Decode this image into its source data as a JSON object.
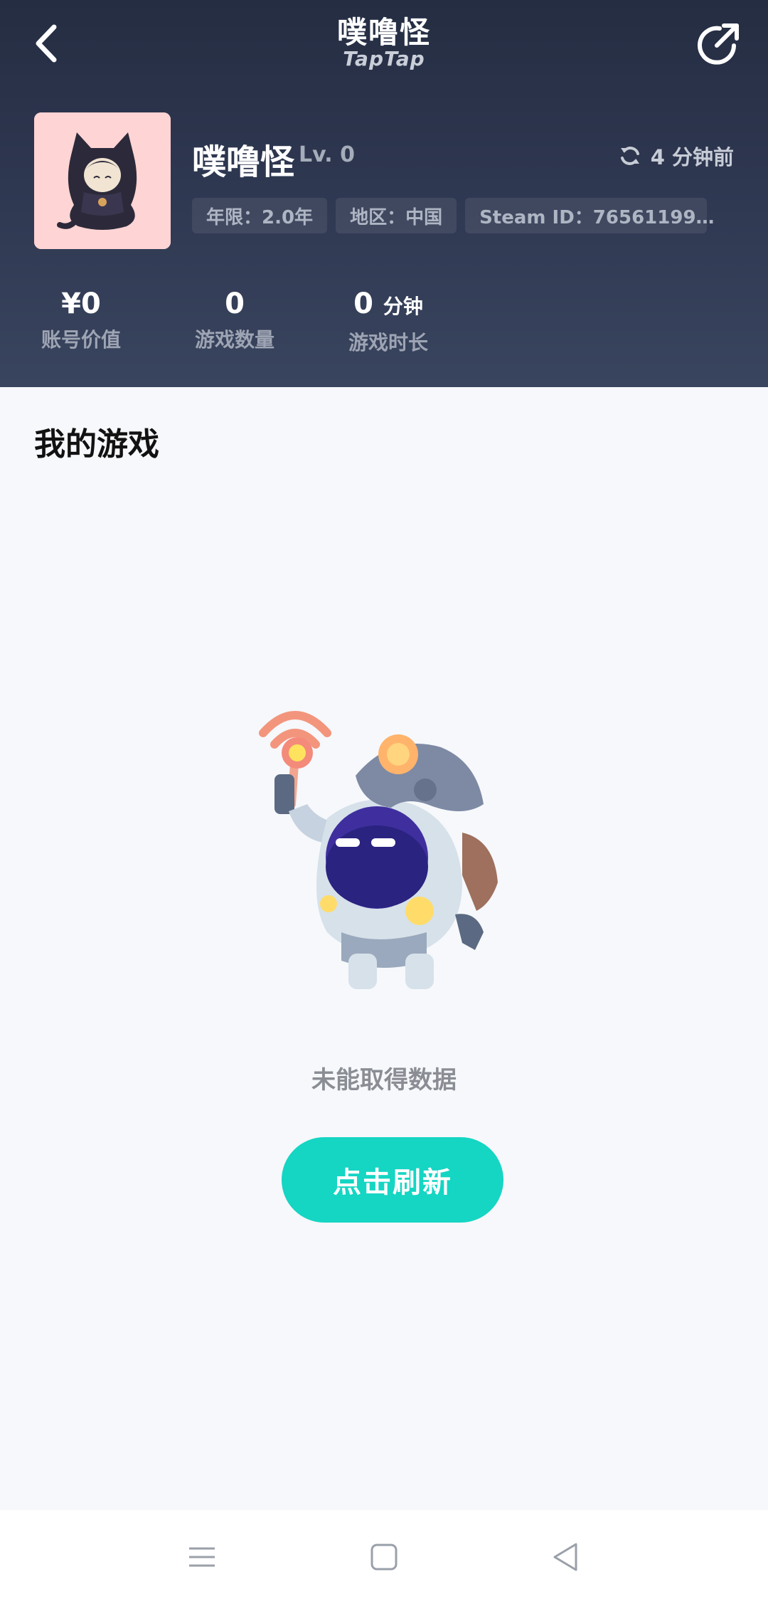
{
  "nav": {
    "title": "噗噜怪",
    "subtitle": "TapTap"
  },
  "profile": {
    "username": "噗噜怪",
    "level": "Lv. 0",
    "updated": "4 分钟前",
    "tags": {
      "years": "年限：2.0年",
      "region": "地区：中国",
      "steam_id": "Steam ID：76561199…"
    }
  },
  "stats": [
    {
      "value": "¥0",
      "label": "账号价值"
    },
    {
      "value": "0",
      "label": "游戏数量"
    },
    {
      "value": "0",
      "unit": "分钟",
      "label": "游戏时长"
    }
  ],
  "main": {
    "section_title": "我的游戏",
    "empty_text": "未能取得数据",
    "refresh_label": "点击刷新"
  },
  "icons": [
    "back-arrow-icon",
    "share-icon",
    "refresh-sync-icon",
    "copy-icon",
    "menu-icon",
    "home-square-icon",
    "back-triangle-icon"
  ],
  "colors": {
    "header": "#2e3750",
    "accent": "#15d5c3",
    "background": "#f6f8fb"
  }
}
